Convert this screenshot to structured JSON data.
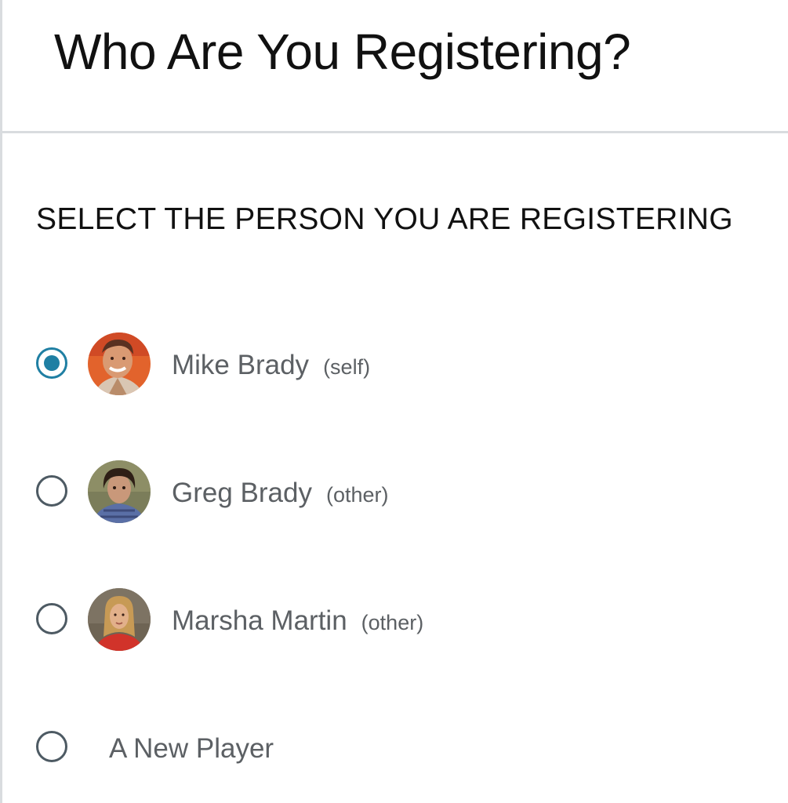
{
  "header": {
    "title": "Who Are You Registering?"
  },
  "section": {
    "title": "SELECT THE PERSON YOU ARE REGISTERING"
  },
  "options": [
    {
      "name": "Mike Brady",
      "tag": "(self)",
      "selected": true,
      "avatar_icon": "person-photo-icon"
    },
    {
      "name": "Greg Brady",
      "tag": "(other)",
      "selected": false,
      "avatar_icon": "person-photo-icon"
    },
    {
      "name": "Marsha Martin",
      "tag": "(other)",
      "selected": false,
      "avatar_icon": "person-photo-icon"
    },
    {
      "name": "A New Player",
      "tag": "",
      "selected": false,
      "avatar_icon": ""
    }
  ],
  "colors": {
    "accent": "#1f7fa3",
    "radio_border": "#4d5a63",
    "name_text": "#5c6064",
    "divider": "#d9dcdf"
  }
}
